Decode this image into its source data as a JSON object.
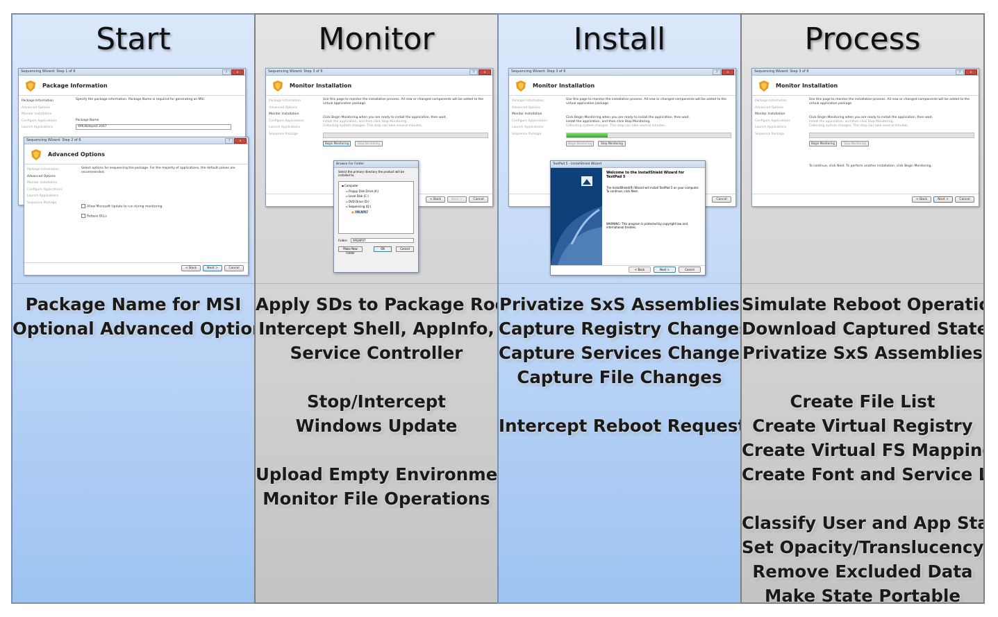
{
  "columns": [
    {
      "title": "Start",
      "lines": [
        "Package Name for MSI",
        "Optional Advanced Options"
      ],
      "windows": {
        "pkg_info": {
          "titlebar": "Sequencing Wizard: Step 1 of 6",
          "header": "Package Information",
          "nav": [
            "Package Information",
            "Advanced Options",
            "Monitor Installation",
            "Configure Applications",
            "Launch Applications"
          ],
          "desc": "Specify the package information. Package Name is required for generating an MSI.",
          "field_label": "Package Name",
          "field_value": "XMLNotepad 2007"
        },
        "adv_opts": {
          "titlebar": "Sequencing Wizard: Step 2 of 6",
          "header": "Advanced Options",
          "nav": [
            "Package Information",
            "Advanced Options",
            "Monitor Installation",
            "Configure Applications",
            "Launch Applications",
            "Sequence Package"
          ],
          "desc": "Select options for sequencing the package. For the majority of applications, the default values are recommended.",
          "check1": "Allow Microsoft Update to run during monitoring",
          "check2": "Rebase DLLs",
          "back": "< Back",
          "next": "Next >",
          "cancel": "Cancel"
        }
      }
    },
    {
      "title": "Monitor",
      "lines": [
        "Apply SDs to Package Root",
        "Intercept Shell, AppInfo,",
        "Service Controller",
        "",
        "Stop/Intercept",
        "Windows Update",
        "",
        "Upload Empty Environment",
        "Monitor File Operations"
      ],
      "windows": {
        "mon": {
          "titlebar": "Sequencing Wizard: Step 3 of 6",
          "header": "Monitor Installation",
          "nav": [
            "Package Information",
            "Advanced Options",
            "Monitor Installation",
            "Configure Applications",
            "Launch Applications",
            "Sequence Package"
          ],
          "desc": "Use this page to monitor the installation process. All new or changed components will be added to the virtual application package.",
          "step1": "Click Begin Monitoring when you are ready to install the application, then wait.",
          "step2": "Install the application, and then click Stop Monitoring.",
          "step3": "Collecting system changes. This step can take several minutes.",
          "begin": "Begin Monitoring",
          "stop": "Stop Monitoring",
          "back": "< Back",
          "next": "Next >",
          "cancel": "Cancel"
        },
        "browse": {
          "titlebar": "Browse For Folder",
          "desc": "Select the primary directory the product will be installed to.",
          "tree": [
            "Computer",
            "Floppy Disk Drive (A:)",
            "Local Disk (C:)",
            "DVD Drive (D:)",
            "Sequencing (Q:)",
            "XMLNP07"
          ],
          "folder_label": "Folder:",
          "folder_value": "XMLNP07",
          "new_folder": "Make New Folder",
          "ok": "OK",
          "cancel": "Cancel"
        }
      }
    },
    {
      "title": "Install",
      "lines": [
        "Privatize SxS Assemblies",
        "Capture Registry Changes",
        "Capture Services Changes",
        "Capture File Changes",
        "",
        "Intercept Reboot Requests"
      ],
      "windows": {
        "mon": {
          "titlebar": "Sequencing Wizard: Step 3 of 6",
          "header": "Monitor Installation",
          "nav": [
            "Package Information",
            "Advanced Options",
            "Monitor Installation",
            "Configure Applications",
            "Launch Applications",
            "Sequence Package"
          ],
          "desc": "Use this page to monitor the installation process. All new or changed components will be added to the virtual application package.",
          "step1": "Click Begin Monitoring when you are ready to install the application, then wait.",
          "step2": "Install the application, and then click Stop Monitoring.",
          "step3": "Collecting system changes. This step can take several minutes.",
          "begin": "Begin Monitoring",
          "stop": "Stop Monitoring",
          "cancel": "Cancel"
        },
        "installer": {
          "titlebar": "TextPad 5 - InstallShield Wizard",
          "welcome": "Welcome to the InstallShield Wizard for TextPad 5",
          "desc": "The InstallShield(R) Wizard will install TextPad 5 on your computer. To continue, click Next.",
          "warning": "WARNING: This program is protected by copyright law and international treaties.",
          "back": "< Back",
          "next": "Next >",
          "cancel": "Cancel"
        }
      }
    },
    {
      "title": "Process",
      "lines": [
        "Simulate Reboot Operations",
        "Download Captured State",
        "Privatize SxS Assemblies",
        "",
        "Create File List",
        "Create Virtual Registry",
        "Create Virtual FS Mappings",
        "Create Font and Service List",
        "",
        "Classify User and App State",
        "Set Opacity/Translucency",
        "Remove Excluded Data",
        "Make State Portable"
      ],
      "windows": {
        "mon": {
          "titlebar": "Sequencing Wizard: Step 3 of 6",
          "header": "Monitor Installation",
          "nav": [
            "Package Information",
            "Advanced Options",
            "Monitor Installation",
            "Configure Applications",
            "Launch Applications",
            "Sequence Package"
          ],
          "desc": "Use this page to monitor the installation process. All new or changed components will be added to the virtual application package.",
          "step1": "Click Begin Monitoring when you are ready to install the application, then wait.",
          "step2": "Install the application, and then click Stop Monitoring.",
          "step3": "Collecting system changes. This step can take several minutes.",
          "begin": "Begin Monitoring",
          "stop": "Stop Monitoring",
          "done": "To continue, click Next. To perform another installation, click Begin Monitoring.",
          "back": "< Back",
          "next": "Next >",
          "cancel": "Cancel"
        }
      }
    }
  ],
  "colors": {
    "blue_panel": "#c6dbf7",
    "grey_panel": "#d6d6d6",
    "progress_green": "#2fae27"
  }
}
